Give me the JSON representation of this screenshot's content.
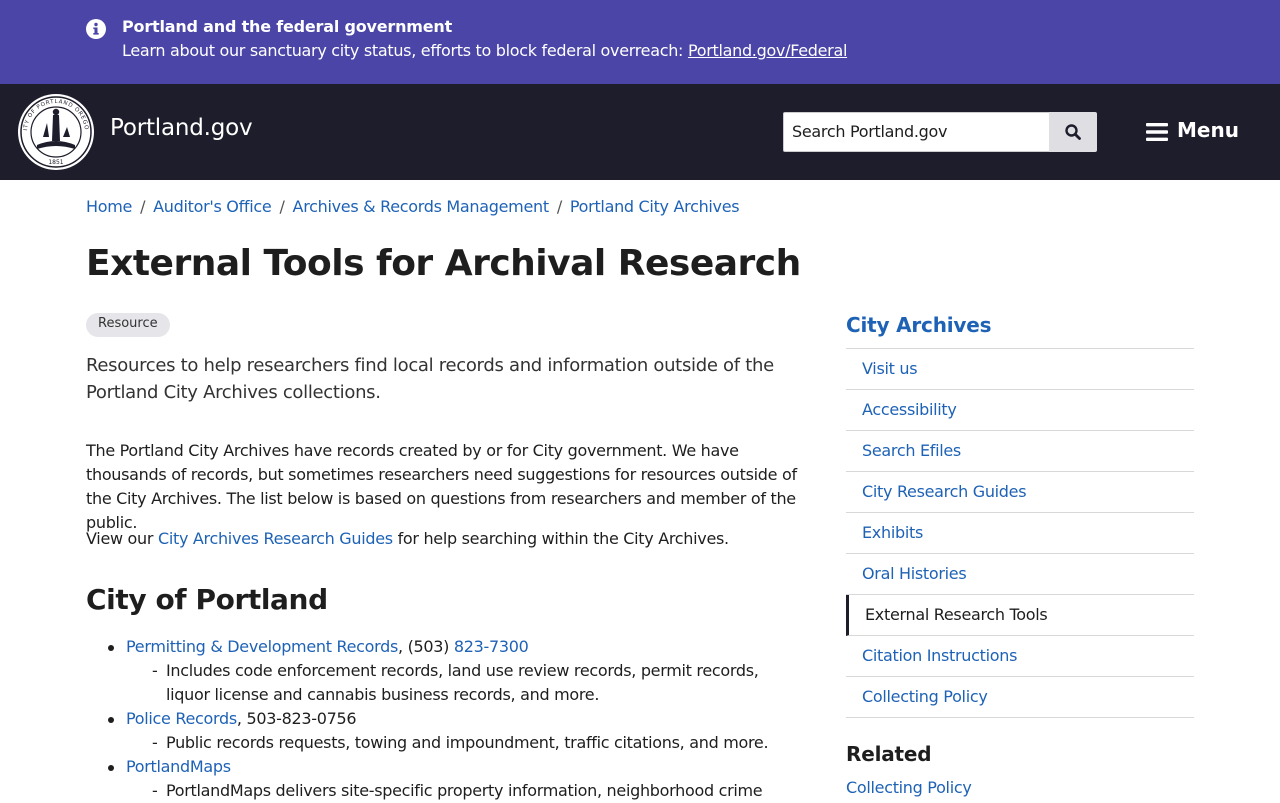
{
  "alert": {
    "title": "Portland and the federal government",
    "text": "Learn about our sanctuary city status, efforts to block federal overreach: ",
    "link": "Portland.gov/Federal",
    "icon": "info-icon"
  },
  "header": {
    "site_name": "Portland.gov",
    "search_placeholder": "Search Portland.gov",
    "menu_label": "Menu",
    "seal_text": "CITY OF PORTLAND OREGON",
    "seal_year": "1851"
  },
  "breadcrumb": [
    {
      "label": "Home"
    },
    {
      "label": "Auditor's Office"
    },
    {
      "label": "Archives & Records Management"
    },
    {
      "label": "Portland City Archives"
    }
  ],
  "main": {
    "title": "External Tools for Archival Research",
    "badge": "Resource",
    "lede": "Resources to help researchers find local records and information outside of the Portland City Archives collections.",
    "p1": "The Portland City Archives have records created by or for City government. We have thousands of records, but sometimes researchers need suggestions for resources outside of the City Archives. The list below is based on questions from researchers and member of the public.",
    "p2_prefix": "View our ",
    "p2_link": "City Archives Research Guides",
    "p2_suffix": " for help searching within the City Archives.",
    "section_heading": "City of Portland",
    "items": [
      {
        "link": "Permitting & Development Records",
        "after": ", (503) ",
        "link2": "823-7300",
        "desc": "Includes code enforcement records, land use review records, permit records, liquor license and cannabis business records, and more."
      },
      {
        "link": "Police Records",
        "after": ", 503-823-0756",
        "desc": "Public records requests, towing and impoundment, traffic citations, and more."
      },
      {
        "link": "PortlandMaps",
        "after": "",
        "desc": "PortlandMaps delivers site-specific property information, neighborhood crime"
      }
    ]
  },
  "sidebar": {
    "title": "City Archives",
    "items": [
      {
        "label": "Visit us"
      },
      {
        "label": "Accessibility"
      },
      {
        "label": "Search Efiles"
      },
      {
        "label": "City Research Guides"
      },
      {
        "label": "Exhibits"
      },
      {
        "label": "Oral Histories"
      },
      {
        "label": "External Research Tools"
      },
      {
        "label": "Citation Instructions"
      },
      {
        "label": "Collecting Policy"
      }
    ],
    "active_index": 6,
    "related_heading": "Related",
    "related_link": "Collecting Policy"
  },
  "colors": {
    "alert_bg": "#4a45a6",
    "header_bg": "#1d1d2c",
    "link": "#1e62b6"
  }
}
